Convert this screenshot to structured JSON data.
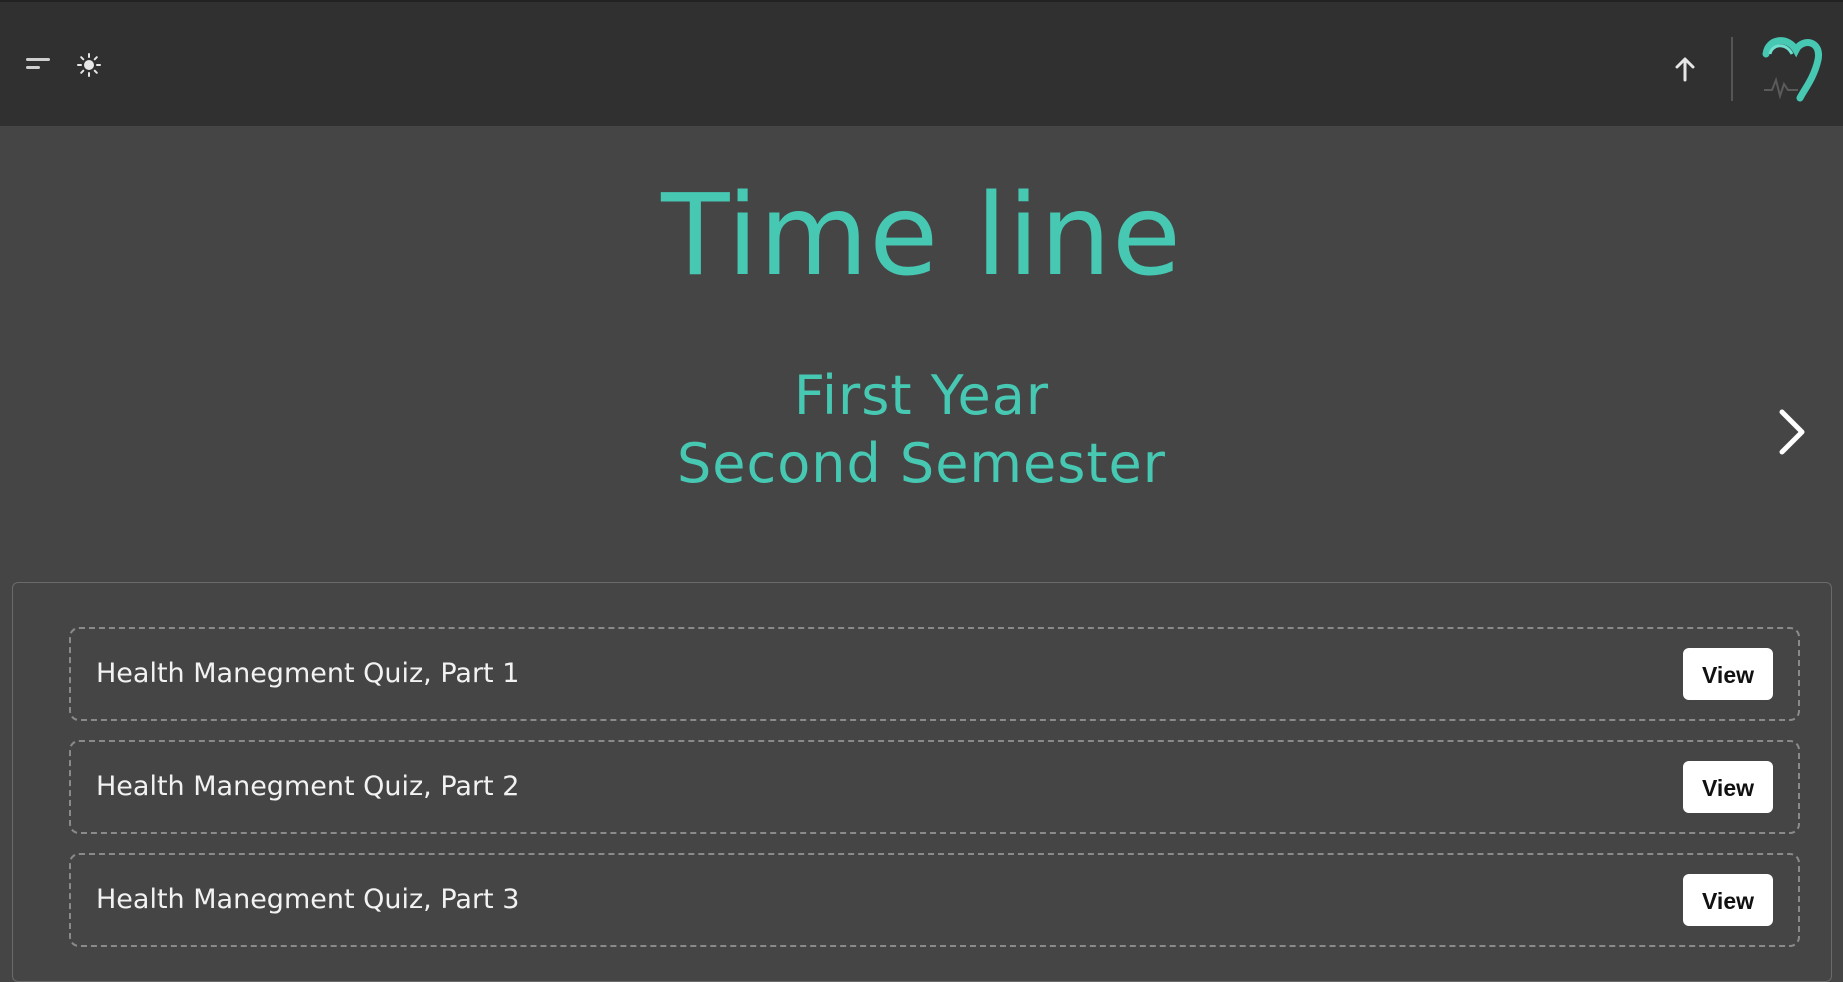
{
  "header": {
    "menu_icon": "menu-icon",
    "theme_icon": "sun-icon",
    "scroll_top_icon": "arrow-up-icon",
    "logo_icon": "heart-pulse-logo",
    "accent_color": "#46c8b3"
  },
  "page": {
    "title": "Time line",
    "year": "First Year",
    "semester": "Second Semester",
    "next_icon": "chevron-right-icon"
  },
  "quizzes": [
    {
      "label": "Health Manegment Quiz, Part 1",
      "button": "View"
    },
    {
      "label": "Health Manegment Quiz, Part 2",
      "button": "View"
    },
    {
      "label": "Health Manegment Quiz, Part 3",
      "button": "View"
    }
  ]
}
